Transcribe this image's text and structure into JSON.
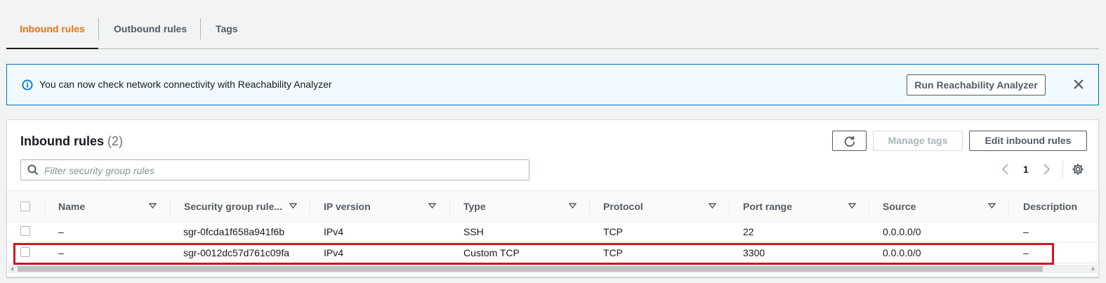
{
  "tabs": [
    {
      "label": "Inbound rules",
      "active": true
    },
    {
      "label": "Outbound rules",
      "active": false
    },
    {
      "label": "Tags",
      "active": false
    }
  ],
  "flash": {
    "icon": "info-icon",
    "message": "You can now check network connectivity with Reachability Analyzer",
    "action_label": "Run Reachability Analyzer"
  },
  "panel": {
    "title": "Inbound rules",
    "count": "(2)",
    "manage_tags_label": "Manage tags",
    "edit_label": "Edit inbound rules",
    "filter_placeholder": "Filter security group rules",
    "page": "1"
  },
  "table": {
    "headers": [
      "Name",
      "Security group rule...",
      "IP version",
      "Type",
      "Protocol",
      "Port range",
      "Source",
      "Description"
    ],
    "rows": [
      {
        "name": "–",
        "rule_id": "sgr-0fcda1f658a941f6b",
        "ip_version": "IPv4",
        "type": "SSH",
        "protocol": "TCP",
        "port_range": "22",
        "source": "0.0.0.0/0",
        "description": "–",
        "highlighted": false
      },
      {
        "name": "–",
        "rule_id": "sgr-0012dc57d761c09fa",
        "ip_version": "IPv4",
        "type": "Custom TCP",
        "protocol": "TCP",
        "port_range": "3300",
        "source": "0.0.0.0/0",
        "description": "–",
        "highlighted": true
      }
    ]
  },
  "colors": {
    "accent": "#ec7211",
    "info_border": "#0073bb",
    "info_bg": "#f1faff",
    "highlight": "#d0161e"
  }
}
